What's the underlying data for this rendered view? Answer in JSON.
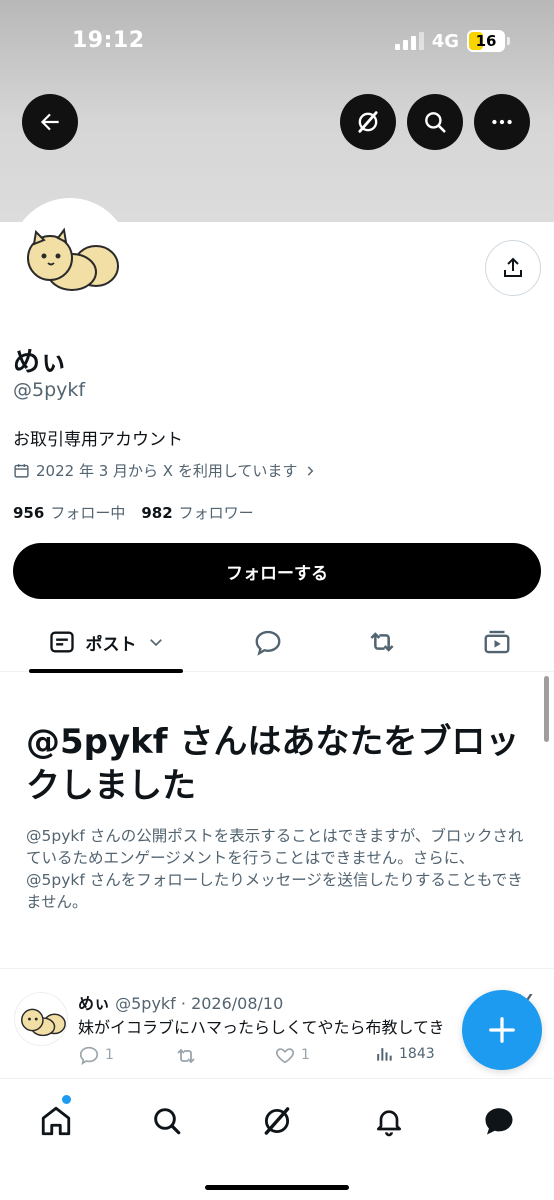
{
  "status_bar": {
    "time": "19:12",
    "network": "4G",
    "battery": "16"
  },
  "profile": {
    "display_name": "めぃ",
    "handle": "@5pykf",
    "bio": "お取引専用アカウント",
    "joined": "2022 年 3 月から X を利用しています",
    "following_count": "956",
    "following_label": "フォロー中",
    "followers_count": "982",
    "followers_label": "フォロワー",
    "follow_button": "フォローする"
  },
  "tabs": {
    "posts_label": "ポスト"
  },
  "blocked": {
    "title": "@5pykf さんはあなたをブロックしました",
    "description": "@5pykf さんの公開ポストを表示することはできますが、ブロックされているためエンゲージメントを行うことはできません。さらに、@5pykf さんをフォローしたりメッセージを送信したりすることもできません。"
  },
  "post": {
    "author_name": "めぃ",
    "author_meta": "@5pykf · 2026/08/10",
    "text": "妹がイコラブにハマったらしくてやたら布教してき",
    "reply_count": "1",
    "like_count": "1",
    "view_count": "1843",
    "close": "X"
  },
  "colors": {
    "accent": "#1d9bf0",
    "text": "#0f1419",
    "muted": "#536471",
    "button": "#000000"
  },
  "icons": [
    "back-arrow-icon",
    "grok-icon",
    "search-icon",
    "more-icon",
    "share-icon",
    "calendar-icon",
    "chevron-right-icon",
    "posts-tab-icon",
    "chevron-down-icon",
    "reply-icon",
    "repost-icon",
    "media-icon",
    "like-icon",
    "views-icon",
    "plus-icon",
    "home-icon",
    "bell-icon",
    "messages-icon"
  ]
}
